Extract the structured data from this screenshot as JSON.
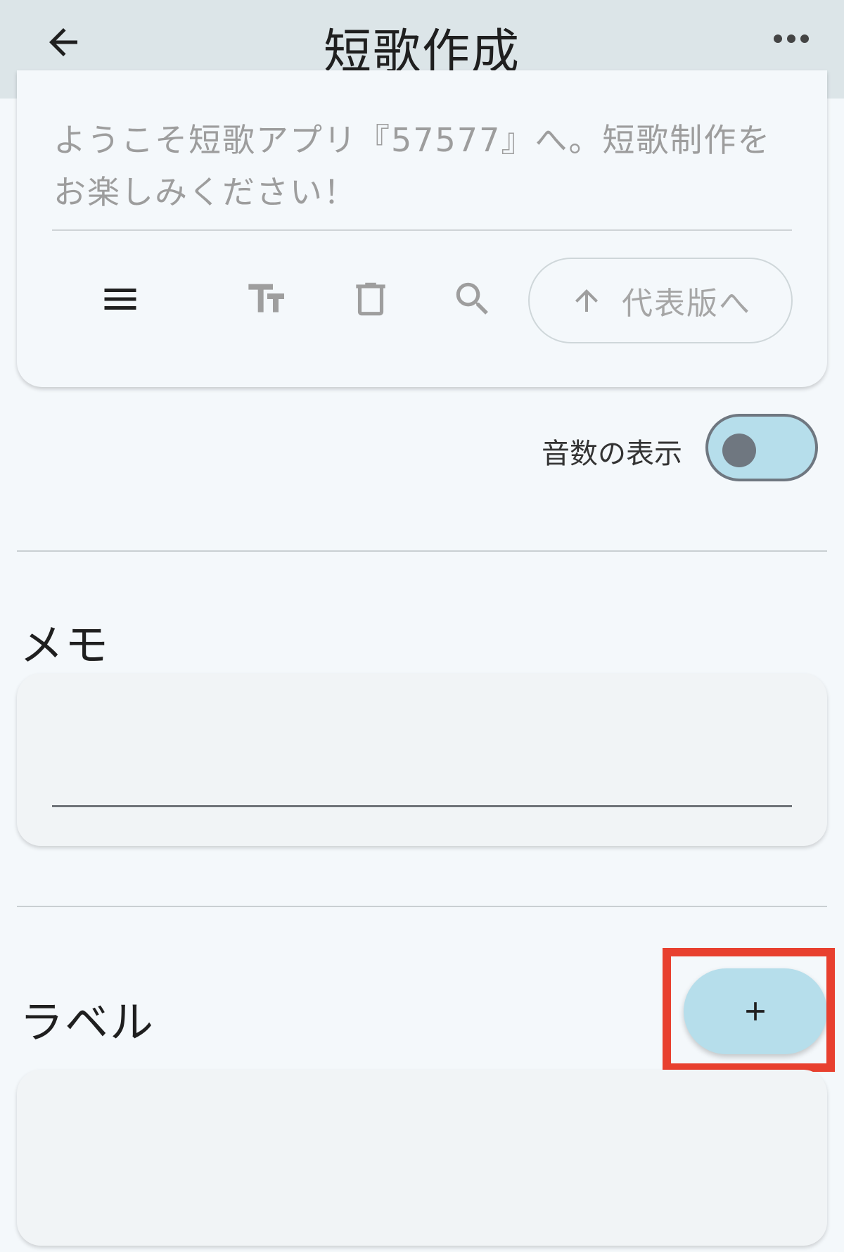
{
  "header": {
    "title": "短歌作成",
    "back_icon": "arrow-left-icon",
    "menu_icon": "more-horizontal-icon"
  },
  "editor": {
    "text": "ようこそ短歌アプリ『57577』へ。短歌制作をお楽しみください！",
    "toolbar": {
      "icons": [
        "menu-icon",
        "text-size-icon",
        "trash-icon",
        "search-icon"
      ],
      "representative_button_label": "代表版へ",
      "representative_button_icon": "arrow-up-icon"
    }
  },
  "syllable_toggle": {
    "label": "音数の表示",
    "enabled": false
  },
  "memo": {
    "title": "メモ",
    "value": ""
  },
  "labels": {
    "title": "ラベル",
    "add_button_icon": "plus-icon"
  },
  "colors": {
    "app_bar": "#dce5e8",
    "background": "#f4f8fb",
    "accent": "#b6deeb",
    "highlight": "#e8402f"
  }
}
